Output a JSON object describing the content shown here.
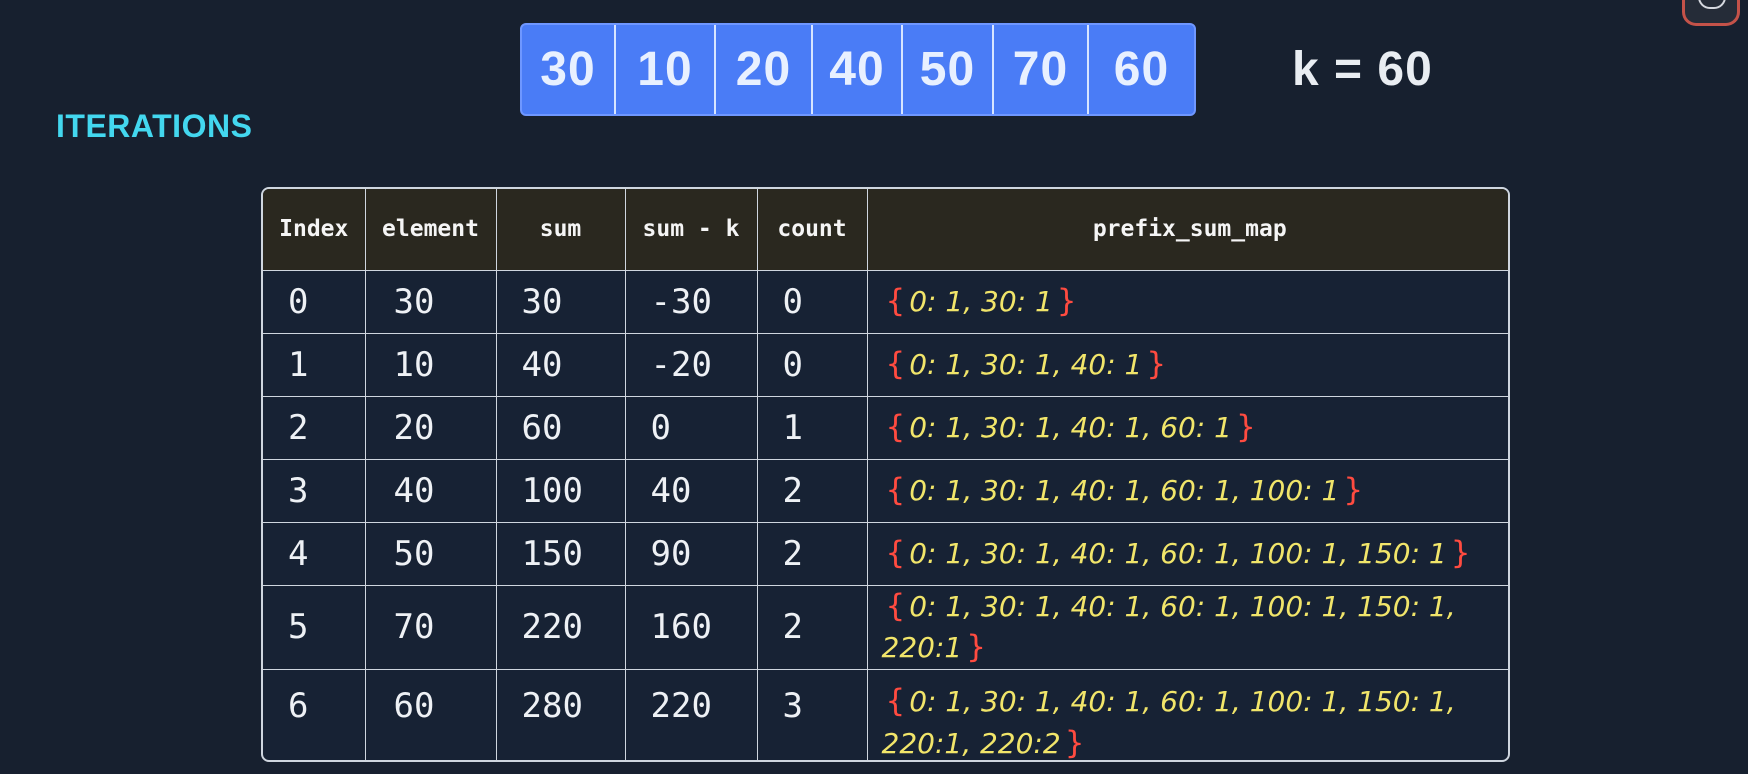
{
  "array": {
    "values": [
      "30",
      "10",
      "20",
      "40",
      "50",
      "70",
      "60"
    ]
  },
  "k_label": "k = 60",
  "section_title": "ITERATIONS",
  "table": {
    "headers": [
      "Index",
      "element",
      "sum",
      "sum - k",
      "count",
      "prefix_sum_map"
    ],
    "rows": [
      {
        "index": "0",
        "element": "30",
        "sum": "30",
        "sum_minus_k": "-30",
        "count": "0",
        "prefix_sum_map": "0: 1, 30: 1"
      },
      {
        "index": "1",
        "element": "10",
        "sum": "40",
        "sum_minus_k": "-20",
        "count": "0",
        "prefix_sum_map": "0: 1, 30: 1, 40: 1"
      },
      {
        "index": "2",
        "element": "20",
        "sum": "60",
        "sum_minus_k": "0",
        "count": "1",
        "prefix_sum_map": "0: 1, 30: 1, 40: 1, 60: 1"
      },
      {
        "index": "3",
        "element": "40",
        "sum": "100",
        "sum_minus_k": "40",
        "count": "2",
        "prefix_sum_map": "0: 1, 30: 1, 40: 1, 60: 1, 100: 1"
      },
      {
        "index": "4",
        "element": "50",
        "sum": "150",
        "sum_minus_k": "90",
        "count": "2",
        "prefix_sum_map": "0: 1, 30: 1, 40: 1, 60: 1, 100: 1, 150: 1"
      },
      {
        "index": "5",
        "element": "70",
        "sum": "220",
        "sum_minus_k": "160",
        "count": "2",
        "prefix_sum_map": "0: 1, 30: 1, 40: 1, 60: 1, 100: 1, 150: 1,  220:1"
      },
      {
        "index": "6",
        "element": "60",
        "sum": "280",
        "sum_minus_k": "220",
        "count": "3",
        "prefix_sum_map": "0: 1, 30: 1, 40: 1, 60: 1, 100: 1, 150: 1,  220:1, 220:2"
      }
    ]
  },
  "colors": {
    "background": "#17202f",
    "array_fill": "#4a7cf6",
    "title_cyan": "#43d7ef",
    "map_text": "#f1e56a",
    "brace_red": "#ff4b40",
    "table_header_bg": "#2a281f"
  }
}
